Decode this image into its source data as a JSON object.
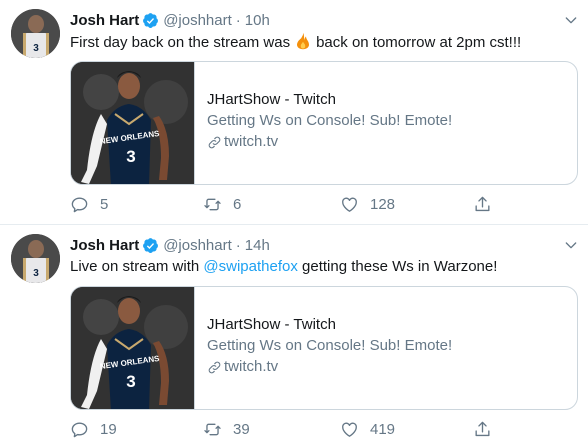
{
  "tweets": [
    {
      "author_name": "Josh Hart",
      "handle": "@joshhart",
      "separator": "·",
      "time": "10h",
      "text_before": "First day back on the stream was",
      "text_after": "back on tomorrow at 2pm cst!!!",
      "emoji": "fire-emoji",
      "card": {
        "title": "JHartShow - Twitch",
        "description": "Getting Ws on Console! Sub! Emote!",
        "domain": "twitch.tv",
        "image_jersey_text": "NEW ORLEANS",
        "image_jersey_number": "3"
      },
      "counts": {
        "replies": "5",
        "retweets": "6",
        "likes": "128"
      }
    },
    {
      "author_name": "Josh Hart",
      "handle": "@joshhart",
      "separator": "·",
      "time": "14h",
      "text_before": "Live on stream with",
      "mention": "@swipathefox",
      "text_after": "getting these Ws in Warzone!",
      "card": {
        "title": "JHartShow - Twitch",
        "description": "Getting Ws on Console! Sub! Emote!",
        "domain": "twitch.tv",
        "image_jersey_text": "NEW ORLEANS",
        "image_jersey_number": "3"
      },
      "counts": {
        "replies": "19",
        "retweets": "39",
        "likes": "419"
      }
    }
  ],
  "avatar_jersey_number": "3",
  "colors": {
    "accent": "#1da1f2",
    "text": "#14171a",
    "muted": "#657786",
    "border": "#ccd6dd",
    "jersey_navy": "#0c2340",
    "jersey_gold": "#c8a96e"
  },
  "icons": [
    "verified-badge-icon",
    "chevron-down-icon",
    "fire-emoji",
    "link-icon",
    "reply-icon",
    "retweet-icon",
    "like-icon",
    "share-icon"
  ]
}
